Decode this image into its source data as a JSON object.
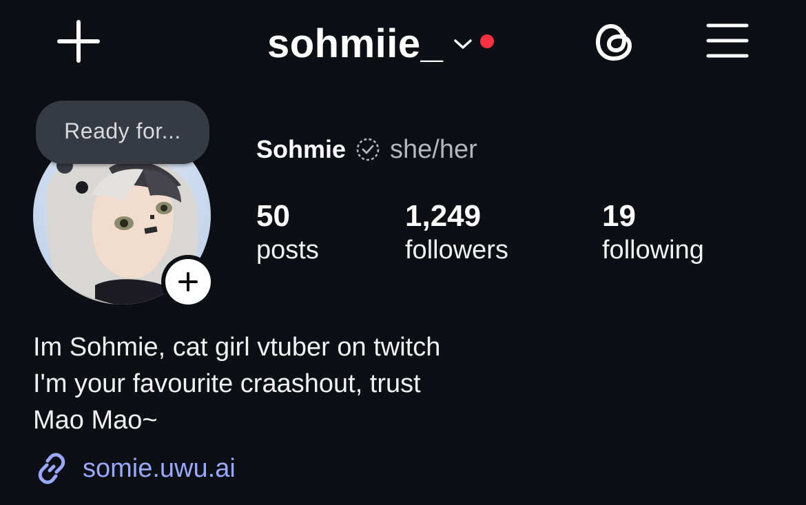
{
  "header": {
    "username": "sohmiie_",
    "icons": {
      "new_post": "plus-icon",
      "account_switch": "chevron-down-icon",
      "threads": "threads-icon",
      "menu": "hamburger-menu-icon"
    },
    "notification_dot_color": "#ff3040"
  },
  "profile": {
    "note": "Ready for...",
    "display_name": "Sohmie",
    "pronouns": "she/her",
    "stats": [
      {
        "value": "50",
        "label": "posts"
      },
      {
        "value": "1,249",
        "label": "followers"
      },
      {
        "value": "19",
        "label": "following"
      }
    ],
    "bio_lines": [
      "Im Sohmie, cat girl vtuber on twitch",
      "I'm your favourite craashout, trust",
      "Mao Mao~"
    ],
    "link": "somie.uwu.ai",
    "link_color": "#9aa8ff"
  }
}
